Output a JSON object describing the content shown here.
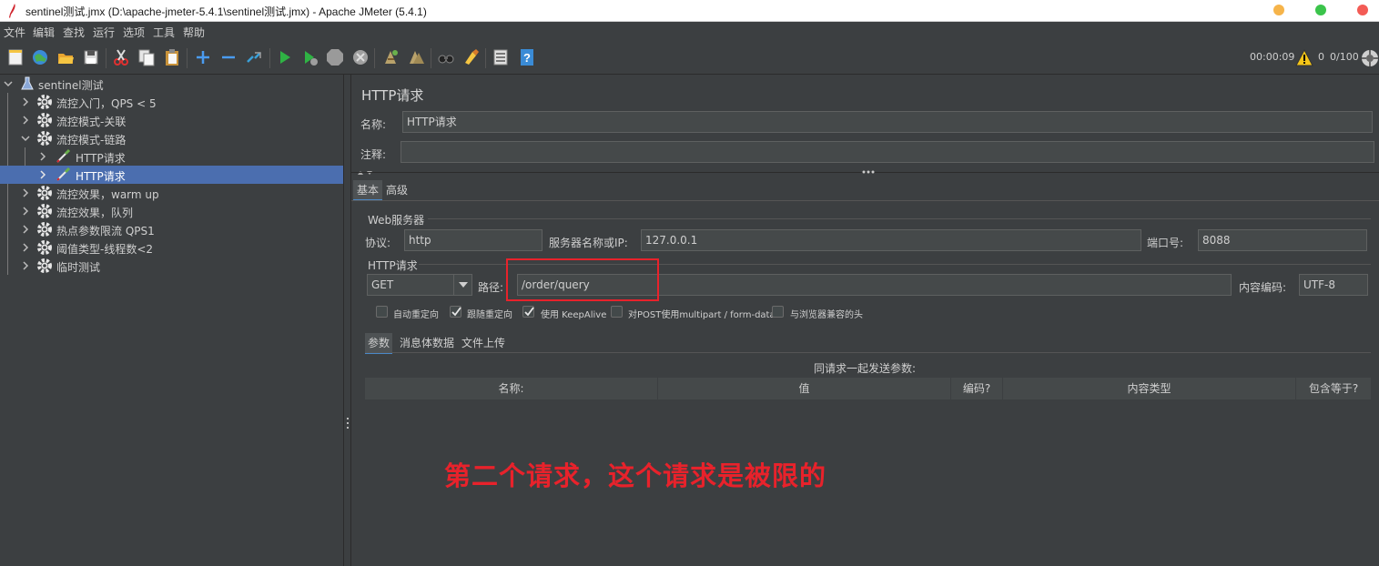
{
  "window": {
    "title": "sentinel测试.jmx (D:\\apache-jmeter-5.4.1\\sentinel测试.jmx) - Apache JMeter (5.4.1)"
  },
  "menu": [
    "文件",
    "编辑",
    "查找",
    "运行",
    "选项",
    "工具",
    "帮助"
  ],
  "toolbar": {
    "icons": [
      "new-icon",
      "templates-icon",
      "open-icon",
      "save-icon",
      "cut-icon",
      "copy-icon",
      "paste-icon",
      "expand-icon",
      "collapse-icon",
      "toggle-icon",
      "start-icon",
      "start-no-pause-icon",
      "stop-icon",
      "shutdown-icon",
      "clear-icon",
      "clear-all-icon",
      "search-icon",
      "reset-search-icon",
      "function-helper-icon",
      "help-icon"
    ],
    "elapsed": "00:00:09",
    "warnings": "0",
    "threads": "0/100"
  },
  "tree": {
    "root": "sentinel测试",
    "items": [
      {
        "label": "流控入门，QPS < 5",
        "icon": "gear-icon"
      },
      {
        "label": "流控模式-关联",
        "icon": "gear-icon"
      },
      {
        "label": "流控模式-链路",
        "icon": "gear-icon"
      },
      {
        "label": "HTTP请求",
        "icon": "pipette-icon"
      },
      {
        "label": "HTTP请求",
        "icon": "pipette-icon"
      },
      {
        "label": "流控效果，warm up",
        "icon": "gear-icon"
      },
      {
        "label": "流控效果，队列",
        "icon": "gear-icon"
      },
      {
        "label": "热点参数限流 QPS1",
        "icon": "gear-icon"
      },
      {
        "label": "阈值类型-线程数<2",
        "icon": "gear-icon"
      },
      {
        "label": "临时测试",
        "icon": "gear-icon"
      }
    ]
  },
  "panel": {
    "heading": "HTTP请求",
    "name_label": "名称:",
    "name_value": "HTTP请求",
    "comment_label": "注释:",
    "comment_value": "",
    "tabs": [
      "基本",
      "高级"
    ],
    "web_server": {
      "group": "Web服务器",
      "protocol_label": "协议:",
      "protocol_value": "http",
      "server_label": "服务器名称或IP:",
      "server_value": "127.0.0.1",
      "port_label": "端口号:",
      "port_value": "8088"
    },
    "http_request": {
      "group": "HTTP请求",
      "method": "GET",
      "path_label": "路径:",
      "path_value": "/order/query",
      "encoding_label": "内容编码:",
      "encoding_value": "UTF-8"
    },
    "checkboxes": [
      {
        "label": "自动重定向",
        "checked": false
      },
      {
        "label": "跟随重定向",
        "checked": true
      },
      {
        "label": "使用 KeepAlive",
        "checked": true
      },
      {
        "label": "对POST使用multipart / form-data",
        "checked": false
      },
      {
        "label": "与浏览器兼容的头",
        "checked": false
      }
    ],
    "subtabs": [
      "参数",
      "消息体数据",
      "文件上传"
    ],
    "params_title": "同请求一起发送参数:",
    "columns": [
      "名称:",
      "值",
      "编码?",
      "内容类型",
      "包含等于?"
    ]
  },
  "annotation": "第二个请求，这个请求是被限的",
  "colors": {
    "accent_red": "#e8222b",
    "selection": "#4b6eaf",
    "background": "#3c3f41"
  }
}
